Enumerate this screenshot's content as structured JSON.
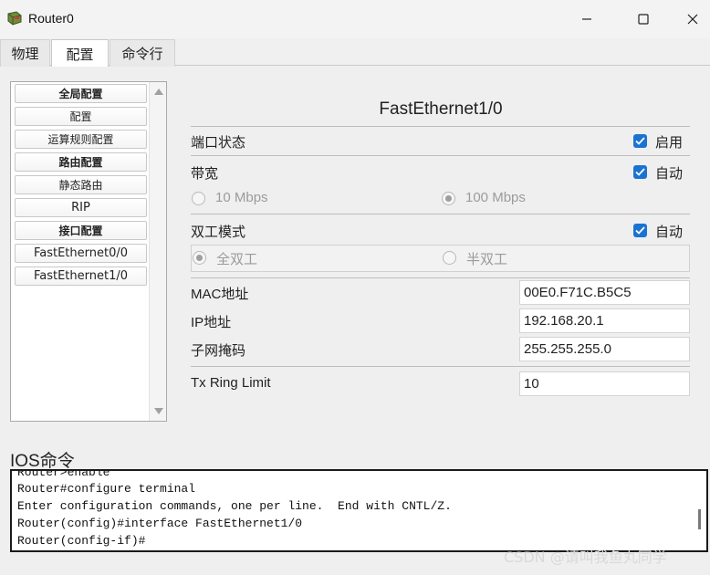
{
  "window": {
    "title": "Router0",
    "icons": [
      "router-app-icon",
      "minimize-icon",
      "maximize-icon",
      "close-icon"
    ]
  },
  "tabs": [
    {
      "label": "物理"
    },
    {
      "label": "配置"
    },
    {
      "label": "命令行"
    }
  ],
  "sidebar": {
    "items": [
      {
        "label": "全局配置"
      },
      {
        "label": "配置"
      },
      {
        "label": "运算规则配置"
      },
      {
        "label": "路由配置"
      },
      {
        "label": "静态路由"
      },
      {
        "label": "RIP"
      },
      {
        "label": "接口配置"
      },
      {
        "label": "FastEthernet0/0"
      },
      {
        "label": "FastEthernet1/0"
      }
    ]
  },
  "panel": {
    "title": "FastEthernet1/0",
    "port_status": {
      "label": "端口状态",
      "checkbox_label": "启用",
      "checked": true
    },
    "bandwidth": {
      "label": "带宽",
      "auto_label": "自动",
      "auto_checked": true,
      "options": [
        {
          "label": "10 Mbps",
          "selected": false
        },
        {
          "label": "100 Mbps",
          "selected": true
        }
      ]
    },
    "duplex": {
      "label": "双工模式",
      "auto_label": "自动",
      "auto_checked": true,
      "options": [
        {
          "label": "全双工",
          "selected": true
        },
        {
          "label": "半双工",
          "selected": false
        }
      ]
    },
    "mac": {
      "label": "MAC地址",
      "value": "00E0.F71C.B5C5"
    },
    "ip": {
      "label": "IP地址",
      "value": "192.168.20.1"
    },
    "mask": {
      "label": "子网掩码",
      "value": "255.255.255.0"
    },
    "tx_ring": {
      "label": "Tx Ring Limit",
      "value": "10"
    }
  },
  "ios": {
    "title": "IOS命令",
    "lines": [
      "Router>enable",
      "Router#configure terminal",
      "Enter configuration commands, one per line.  End with CNTL/Z.",
      "Router(config)#interface FastEthernet1/0",
      "Router(config-if)#"
    ]
  },
  "watermark": "CSDN @请叫我鱼丸同学",
  "colors": {
    "accent": "#1a73d1",
    "background": "#f0f0f0"
  }
}
